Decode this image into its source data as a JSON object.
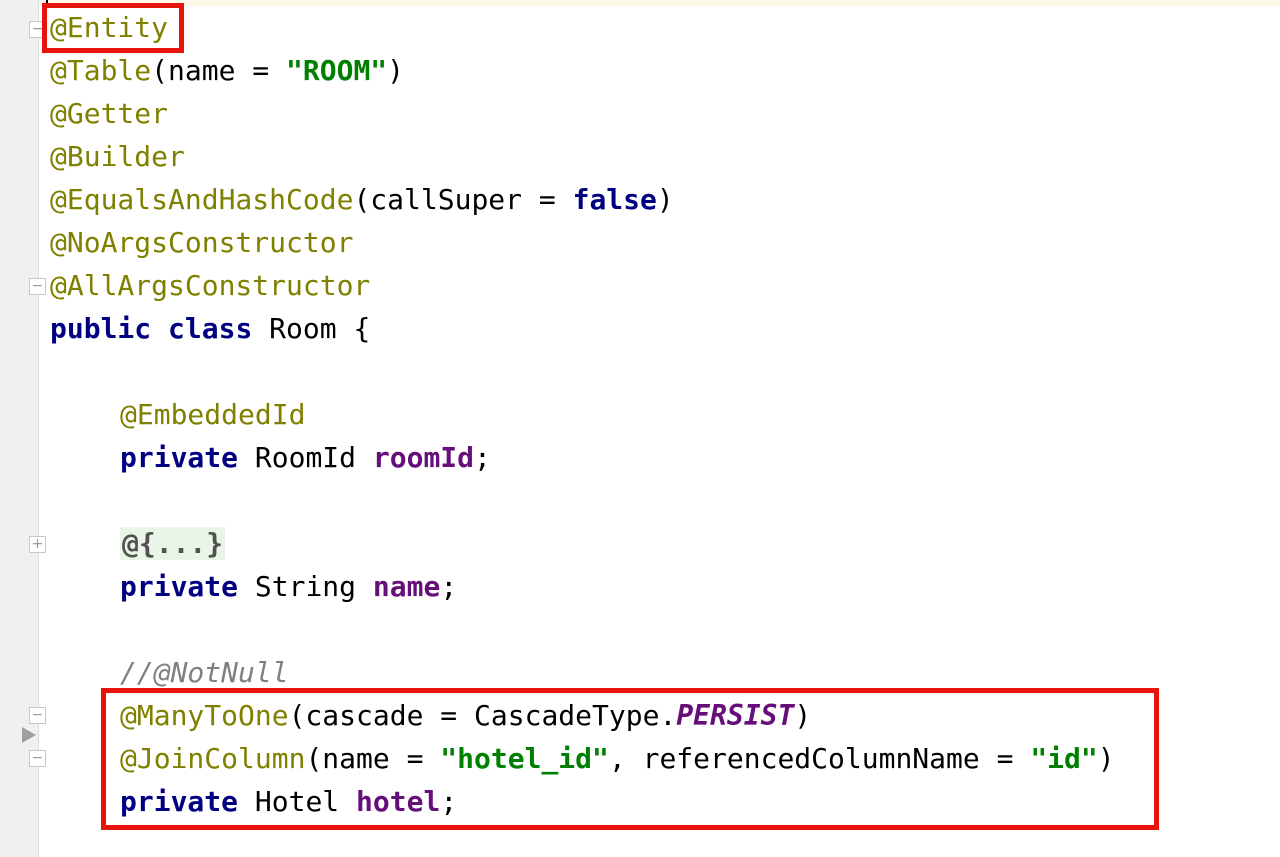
{
  "editor": {
    "annotations": {
      "entity": "@Entity",
      "table": "@Table",
      "getter": "@Getter",
      "builder": "@Builder",
      "equals": "@EqualsAndHashCode",
      "noargs": "@NoArgsConstructor",
      "allargs": "@AllArgsConstructor",
      "embedded": "@EmbeddedId",
      "manytoone": "@ManyToOne",
      "joincolumn": "@JoinColumn"
    },
    "keywords": {
      "public": "public",
      "class": "class",
      "private": "private",
      "false": "false"
    },
    "text": {
      "table_args_open": "(name = ",
      "table_value": "\"ROOM\"",
      "close_paren": ")",
      "equals_args_open": "(callSuper = ",
      "class_name": " Room {",
      "roomid_type": " RoomId ",
      "roomid_field": "roomId",
      "semicolon": ";",
      "folded": "@{...}",
      "string_type": " String ",
      "name_field": "name",
      "comment": "//@NotNull",
      "cascade_open": "(cascade = CascadeType.",
      "cascade_const": "PERSIST",
      "join_open": "(name = ",
      "join_name_value": "\"hotel_id\"",
      "join_mid": ", referencedColumnName = ",
      "join_ref_value": "\"id\"",
      "hotel_type": " Hotel ",
      "hotel_field": "hotel"
    }
  }
}
